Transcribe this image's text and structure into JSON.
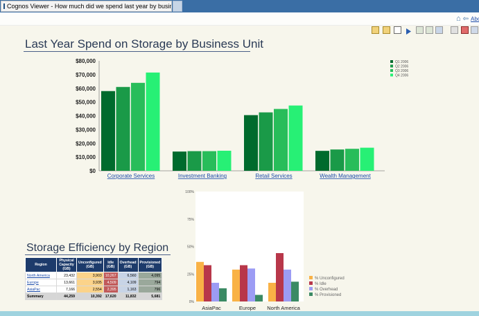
{
  "window": {
    "tab_title": "Cognos Viewer - How much did we spend last year by business unit?",
    "tab_icon": "window-icon"
  },
  "header": {
    "nav_link": "About"
  },
  "report": {
    "title": "Last Year Spend on Storage by Business Unit",
    "subtitle": "Storage Efficiency by Region"
  },
  "chart_data": [
    {
      "type": "bar",
      "title": "",
      "xlabel": "",
      "ylabel": "",
      "categories": [
        "Corporate Services",
        "Investment Banking",
        "Retail Services",
        "Wealth Management"
      ],
      "y_ticks": [
        "$0",
        "$10,000",
        "$20,000",
        "$30,000",
        "$40,000",
        "$50,000",
        "$60,000",
        "$70,000",
        "$80,000"
      ],
      "ylim": [
        0,
        80000
      ],
      "legend_position": "top-right",
      "series": [
        {
          "name": "Q1 2006",
          "color": "#006b2d",
          "values": [
            58000,
            14000,
            40500,
            14500
          ]
        },
        {
          "name": "Q2 2006",
          "color": "#1a9a48",
          "values": [
            61000,
            14300,
            42500,
            15500
          ]
        },
        {
          "name": "Q3 2006",
          "color": "#28bd5a",
          "values": [
            64000,
            14300,
            45000,
            16000
          ]
        },
        {
          "name": "Q4 2006",
          "color": "#27f075",
          "values": [
            71500,
            14600,
            47500,
            16800
          ]
        }
      ]
    },
    {
      "type": "bar",
      "title": "",
      "xlabel": "",
      "ylabel": "",
      "categories": [
        "AsiaPac",
        "Europe",
        "North America"
      ],
      "y_ticks": [
        "0%",
        "25%",
        "50%",
        "75%",
        "100%"
      ],
      "ylim": [
        0,
        100
      ],
      "legend_position": "right",
      "series": [
        {
          "name": "% Unconfigured",
          "color": "#f9b246",
          "values": [
            36,
            29,
            17
          ]
        },
        {
          "name": "% Idle",
          "color": "#b8374a",
          "values": [
            33,
            33,
            44
          ]
        },
        {
          "name": "% Overhead",
          "color": "#9c9cf4",
          "values": [
            17,
            30,
            29
          ]
        },
        {
          "name": "% Provisioned",
          "color": "#3b8a64",
          "values": [
            12,
            6,
            18
          ]
        }
      ]
    },
    {
      "type": "table",
      "columns": [
        "Region",
        "Physical Capacity (GB)",
        "Unconfigured (GB)",
        "Idle (GB)",
        "Overhead (GB)",
        "Provisioned (GB)"
      ],
      "rows": [
        [
          "North America",
          "23,432",
          "3,903",
          "10,267",
          "6,560",
          "4,095"
        ],
        [
          "Europe",
          "13,661",
          "3,935",
          "4,509",
          "4,109",
          "794"
        ],
        [
          "AsiaPac",
          "7,166",
          "2,554",
          "2,395",
          "1,163",
          "796"
        ]
      ],
      "summary": [
        "Summary",
        "44,259",
        "10,392",
        "17,620",
        "11,832",
        "5,681"
      ]
    }
  ]
}
